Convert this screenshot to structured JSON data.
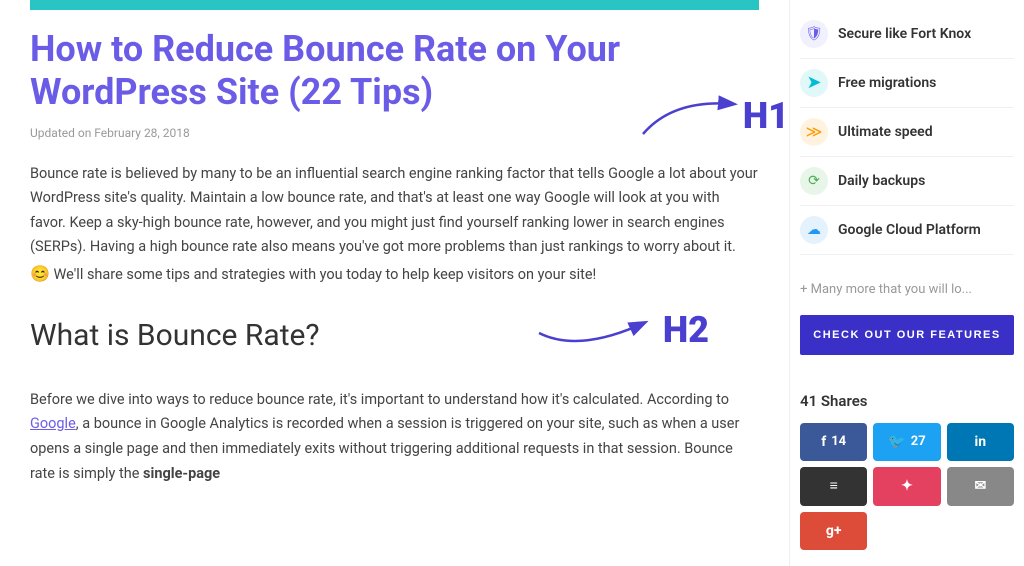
{
  "topbar": {},
  "article": {
    "title": "How to Reduce Bounce Rate on Your WordPress Site (22 Tips)",
    "date_label": "Updated on February 28, 2018",
    "body1": "Bounce rate is believed by many to be an influential search engine ranking factor that tells Google a lot about your WordPress site's quality. Maintain a low bounce rate, and that's at least one way Google will look at you with favor. Keep a sky-high bounce rate, however, and you might just find yourself ranking lower in search engines (SERPs). Having a high bounce rate also means you've got more problems than just rankings to worry about it.",
    "body1_suffix": " We'll share some tips and strategies with you today to help keep visitors on your site!",
    "h2": "What is Bounce Rate?",
    "h1_label": "H1",
    "h2_label": "H2",
    "body2_part1": "Before we dive into ways to reduce bounce rate, it's important to understand how it's calculated. According to ",
    "body2_link": "Google",
    "body2_part2": ", a bounce in Google Analytics is recorded when a session is triggered on your site, such as when a user opens a single page and then immediately exits without triggering additional requests in that session. Bounce rate is simply the ",
    "body2_bold": "single-page"
  },
  "sidebar": {
    "features": [
      {
        "id": "secure",
        "icon": "🛡",
        "icon_class": "icon-shield",
        "label": "Secure like Fort Knox"
      },
      {
        "id": "migrations",
        "icon": "➡",
        "icon_class": "icon-migration",
        "label": "Free migrations"
      },
      {
        "id": "speed",
        "icon": "⚡",
        "icon_class": "icon-speed",
        "label": "Ultimate speed"
      },
      {
        "id": "backups",
        "icon": "🔄",
        "icon_class": "icon-backup",
        "label": "Daily backups"
      },
      {
        "id": "cloud",
        "icon": "☁",
        "icon_class": "icon-cloud",
        "label": "Google Cloud Platform"
      }
    ],
    "more_text": "+ Many more that you will lo...",
    "cta_label": "CHECK OUT OUR FEATURES",
    "shares": {
      "title": "41 Shares",
      "buttons": [
        {
          "id": "facebook",
          "icon": "f",
          "count": "14",
          "class": "social-fb"
        },
        {
          "id": "twitter",
          "icon": "🐦",
          "count": "27",
          "class": "social-tw"
        },
        {
          "id": "linkedin",
          "icon": "in",
          "count": "",
          "class": "social-li"
        },
        {
          "id": "buffer",
          "icon": "≡",
          "count": "",
          "class": "social-buffer"
        },
        {
          "id": "stumble",
          "icon": "✦",
          "count": "",
          "class": "social-sm"
        },
        {
          "id": "email",
          "icon": "✉",
          "count": "",
          "class": "social-email"
        },
        {
          "id": "gplus",
          "icon": "g+",
          "count": "",
          "class": "social-gplus"
        }
      ]
    }
  }
}
